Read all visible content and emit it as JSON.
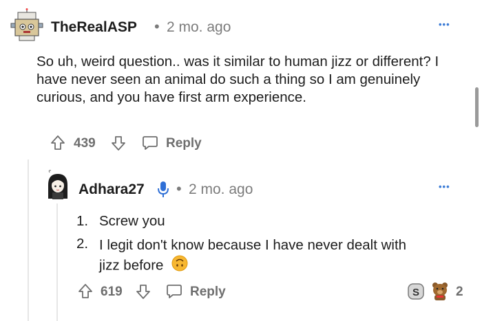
{
  "comment1": {
    "username": "TheRealASP",
    "time": "2 mo. ago",
    "more": "•••",
    "body": "So uh, weird question.. was it similar to human jizz or different? I have never seen an animal do such a thing so I am genuinely curious, and you have first arm experience.",
    "votes": "439",
    "reply_label": "Reply"
  },
  "comment2": {
    "username": "Adhara27",
    "time": "2 mo. ago",
    "more": "•••",
    "list": [
      {
        "num": "1.",
        "text": "Screw you"
      },
      {
        "num": "2.",
        "text": "I legit don't know because I have never dealt with jizz before"
      }
    ],
    "votes": "619",
    "reply_label": "Reply",
    "award_count": "2"
  },
  "colors": {
    "more": "#3b7bd6",
    "text": "#1c1c1c",
    "muted": "#7c7c7c",
    "mic": "#2f6fd6"
  }
}
